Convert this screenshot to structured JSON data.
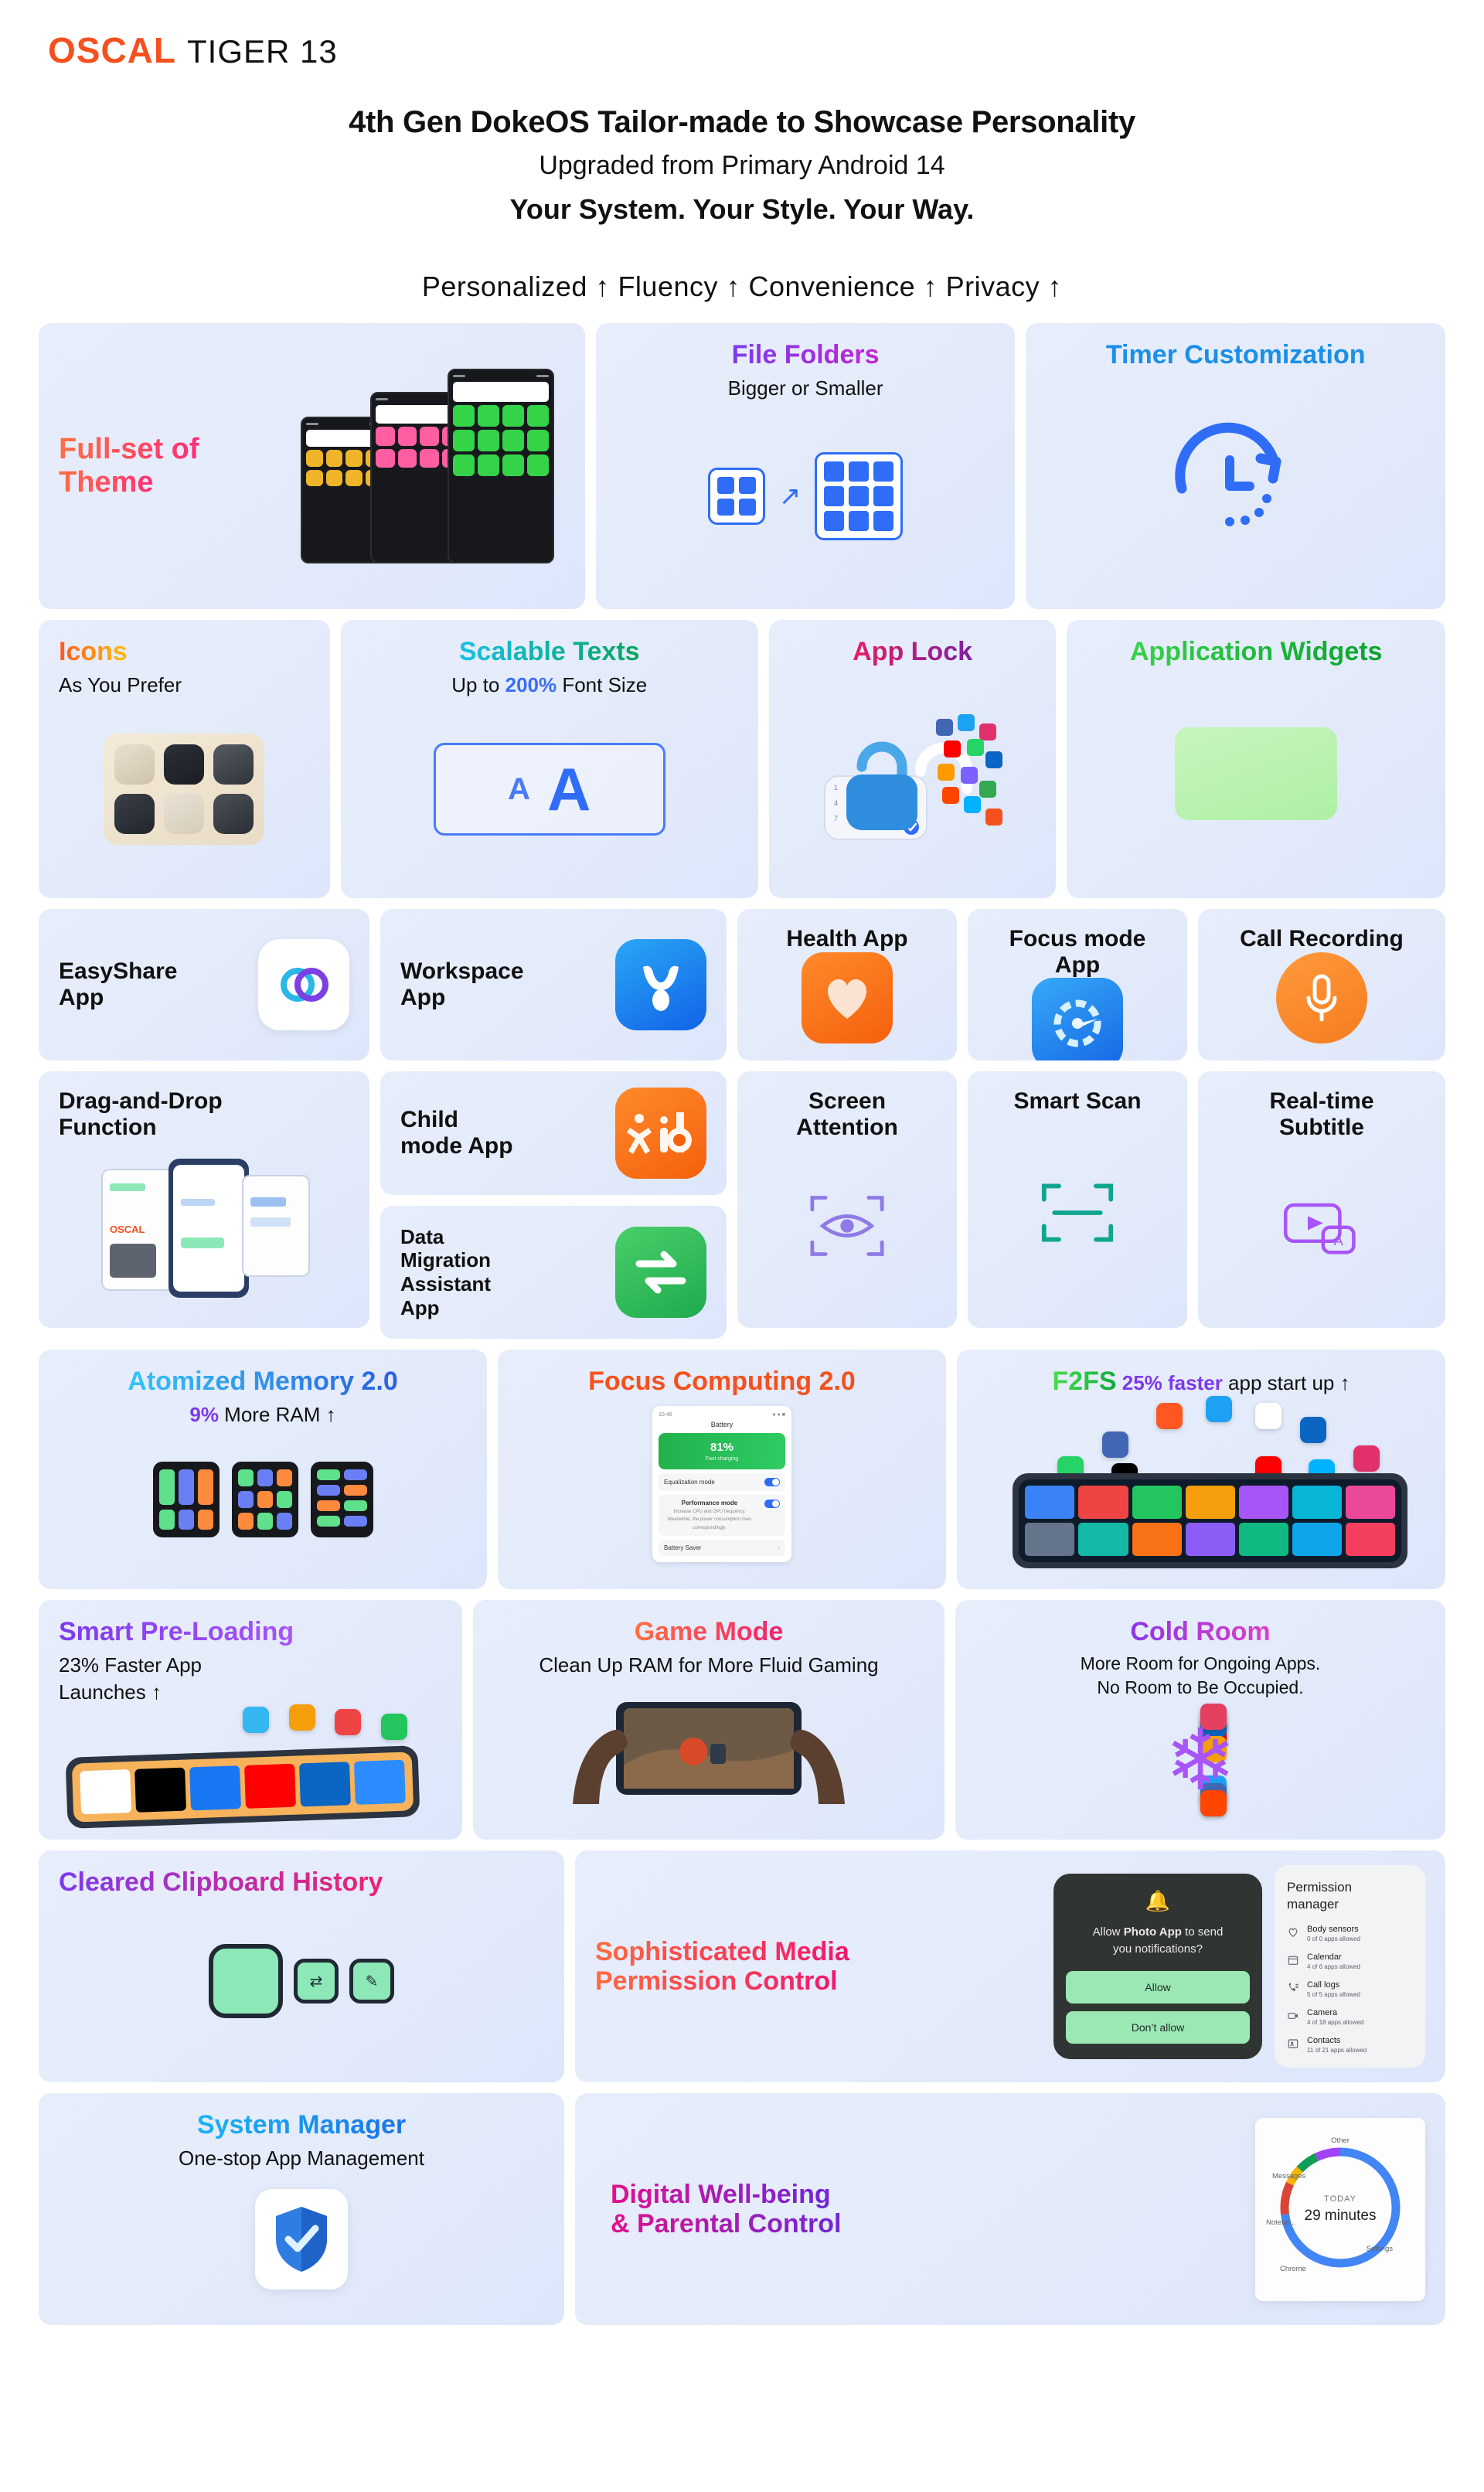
{
  "brand": {
    "name": "OSCAL",
    "model": "TIGER 13",
    "accent": "#f4511e"
  },
  "header": {
    "headline": "4th Gen DokeOS Tailor-made to Showcase Personality",
    "subheadline": "Upgraded from Primary Android 14",
    "tagline": "Your System. Your Style. Your Way.",
    "pillars": "Personalized ↑  Fluency ↑  Convenience ↑  Privacy ↑"
  },
  "cards": {
    "theme": {
      "title_line1": "Full-set of",
      "title_line2": "Theme"
    },
    "file_folders": {
      "title": "File Folders",
      "sub": "Bigger or Smaller"
    },
    "timer": {
      "title": "Timer Customization"
    },
    "icons": {
      "title": "Icons",
      "sub": "As You Prefer"
    },
    "scalable": {
      "title": "Scalable Texts",
      "sub_pre": "Up to ",
      "sub_accent": "200%",
      "sub_post": " Font Size",
      "demo_small": "A",
      "demo_big": "A"
    },
    "app_lock": {
      "title": "App Lock"
    },
    "app_widgets": {
      "title": "Application Widgets"
    },
    "easyshare": {
      "title_line1": "EasyShare",
      "title_line2": "App"
    },
    "workspace": {
      "title_line1": "Workspace",
      "title_line2": "App"
    },
    "health": {
      "title": "Health App"
    },
    "focus_mode": {
      "title": "Focus mode App"
    },
    "call_rec": {
      "title": "Call Recording"
    },
    "drag_drop": {
      "title_line1": "Drag-and-Drop",
      "title_line2": "Function",
      "phone_brand": "OSCAL"
    },
    "child_mode": {
      "title_line1": "Child",
      "title_line2": "mode App",
      "logo_text": "kid"
    },
    "data_migration": {
      "title_line1": "Data",
      "title_line2": "Migration",
      "title_line3": "Assistant",
      "title_line4": "App"
    },
    "screen_attention": {
      "title_line1": "Screen",
      "title_line2": "Attention"
    },
    "smart_scan": {
      "title": "Smart Scan"
    },
    "subtitle": {
      "title_line1": "Real-time",
      "title_line2": "Subtitle",
      "badge": "A"
    },
    "atomized": {
      "title": "Atomized Memory 2.0",
      "sub_accent": "9%",
      "sub_post": " More RAM ↑"
    },
    "focus_comp": {
      "title": "Focus Computing 2.0",
      "battery_panel": {
        "nav_title": "Battery",
        "percent": "81%",
        "percent_sub": "Fast charging",
        "item1": "Equalization mode",
        "item2_line1": "Performance mode",
        "item2_line2": "Increase CPU and GPU frequency. Meanwhile, the power consumption rises correspondingly.",
        "item3": "Battery Saver"
      }
    },
    "f2fs": {
      "title": "F2FS",
      "accent": " 25% faster",
      "post": " app start up ↑"
    },
    "preloading": {
      "title": "Smart Pre-Loading",
      "sub_line1": "23% Faster App",
      "sub_line2": "Launches ↑"
    },
    "game_mode": {
      "title": "Game Mode",
      "sub": "Clean Up RAM for More Fluid Gaming"
    },
    "cold_room": {
      "title": "Cold Room",
      "sub_line1": "More Room for Ongoing Apps.",
      "sub_line2": "No Room to Be Occupied."
    },
    "clipboard": {
      "title": "Cleared Clipboard History"
    },
    "media_perm": {
      "title_line1": "Sophisticated Media",
      "title_line2": "Permission Control",
      "dialog": {
        "q_pre": "Allow ",
        "q_app": "Photo App",
        "q_post": " to send",
        "q_line2": "you notifications?",
        "allow": "Allow",
        "deny": "Don’t allow"
      },
      "manager": {
        "title_line1": "Permission",
        "title_line2": "manager",
        "rows": [
          {
            "icon": "heart-icon",
            "name": "Body sensors",
            "detail": "0 of 0 apps allowed"
          },
          {
            "icon": "calendar-icon",
            "name": "Calendar",
            "detail": "4 of 6 apps allowed"
          },
          {
            "icon": "call-log-icon",
            "name": "Call logs",
            "detail": "5 of 5 apps allowed"
          },
          {
            "icon": "camera-icon",
            "name": "Camera",
            "detail": "4 of 18 apps allowed"
          },
          {
            "icon": "contacts-icon",
            "name": "Contacts",
            "detail": "11 of 21 apps allowed"
          }
        ]
      }
    },
    "sys_manager": {
      "title": "System Manager",
      "sub": "One-stop App Management"
    },
    "wellbeing": {
      "title_line1": "Digital Well-being",
      "title_line2": "& Parental Control"
    }
  },
  "chart_data": {
    "type": "pie",
    "title": "TODAY",
    "center_value": "29 minutes",
    "labels": [
      "Other",
      "Messages",
      "Notebo...",
      "Chrome",
      "Settings"
    ],
    "values": [
      7,
      6,
      5,
      9,
      73
    ],
    "colors": [
      "#a142f4",
      "#0f9d58",
      "#f4b400",
      "#db4437",
      "#4285f4"
    ],
    "legend": "around-ring",
    "unit": "percent-of-day"
  }
}
